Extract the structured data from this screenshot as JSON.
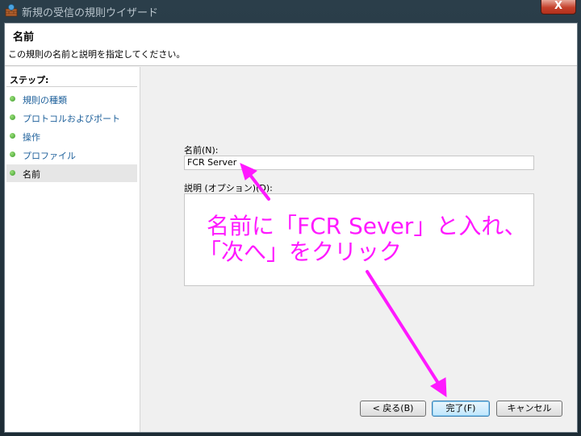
{
  "window": {
    "title": "新規の受信の規則ウイザード",
    "close_label": "X"
  },
  "header": {
    "title": "名前",
    "description": "この規則の名前と説明を指定してください。"
  },
  "sidebar": {
    "steps_label": "ステップ:",
    "items": [
      {
        "label": "規則の種類"
      },
      {
        "label": "プロトコルおよびポート"
      },
      {
        "label": "操作"
      },
      {
        "label": "プロファイル"
      },
      {
        "label": "名前"
      }
    ]
  },
  "form": {
    "name_label": "名前(N):",
    "name_value": "FCR Server",
    "description_label": "説明 (オプション)(D):",
    "description_value": ""
  },
  "buttons": {
    "back": "< 戻る(B)",
    "finish": "完了(F)",
    "cancel": "キャンセル"
  },
  "annotation": {
    "line1": "名前に「FCR Sever」と入れ、",
    "line2": "「次へ」をクリック",
    "color": "#ff19ff"
  }
}
